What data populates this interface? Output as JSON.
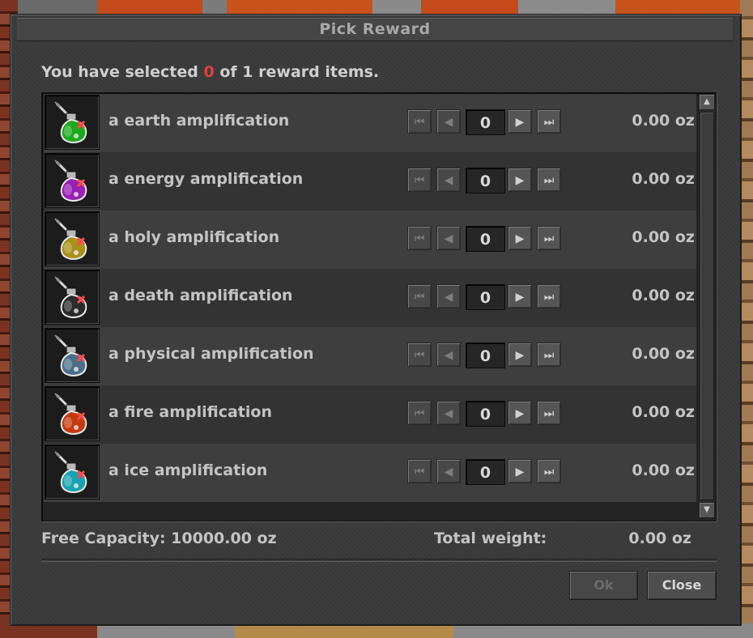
{
  "window": {
    "title": "Pick Reward"
  },
  "selection": {
    "prefix": "You have selected",
    "count": "0",
    "suffix": "of 1 reward items."
  },
  "items": [
    {
      "name": "a earth amplification",
      "quantity": "0",
      "weight": "0.00 oz",
      "color": "#1fa81f",
      "icon": "earth-amplification-icon"
    },
    {
      "name": "a energy amplification",
      "quantity": "0",
      "weight": "0.00 oz",
      "color": "#9a1fb4",
      "icon": "energy-amplification-icon"
    },
    {
      "name": "a holy amplification",
      "quantity": "0",
      "weight": "0.00 oz",
      "color": "#a8901c",
      "icon": "holy-amplification-icon"
    },
    {
      "name": "a death amplification",
      "quantity": "0",
      "weight": "0.00 oz",
      "color": "#2a2a2a",
      "icon": "death-amplification-icon"
    },
    {
      "name": "a physical amplification",
      "quantity": "0",
      "weight": "0.00 oz",
      "color": "#4e6e88",
      "icon": "physical-amplification-icon"
    },
    {
      "name": "a fire amplification",
      "quantity": "0",
      "weight": "0.00 oz",
      "color": "#c43a10",
      "icon": "fire-amplification-icon"
    },
    {
      "name": "a ice amplification",
      "quantity": "0",
      "weight": "0.00 oz",
      "color": "#1aa2b0",
      "icon": "ice-amplification-icon"
    }
  ],
  "footer": {
    "free_capacity": "Free Capacity: 10000.00 oz",
    "total_weight_label": "Total weight:",
    "total_weight_value": "0.00 oz"
  },
  "buttons": {
    "ok": "Ok",
    "close": "Close"
  }
}
